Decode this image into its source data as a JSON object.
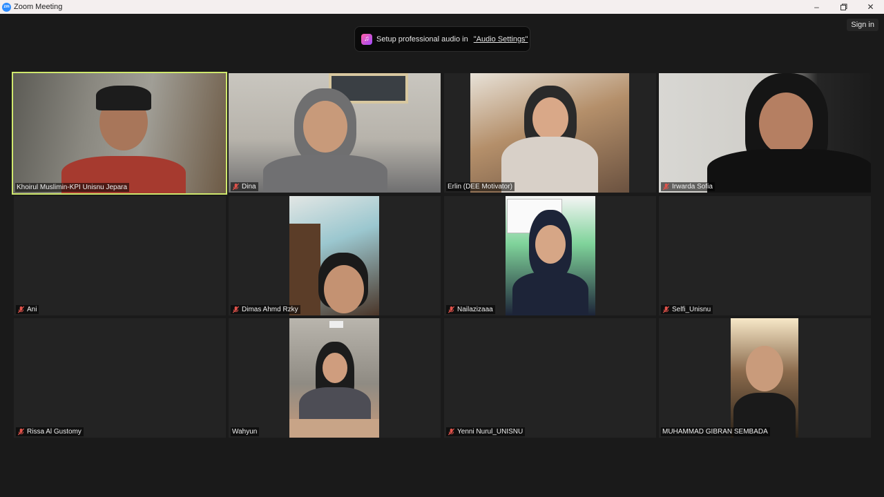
{
  "window": {
    "title": "Zoom Meeting",
    "app_logo": "zm",
    "controls": [
      "minimize-icon",
      "restore-icon",
      "close-icon"
    ]
  },
  "header": {
    "sign_in": "Sign in"
  },
  "notification": {
    "text": "Setup professional audio in",
    "link": "\"Audio Settings\""
  },
  "participants": [
    {
      "name": "Khoirul Muslimin-KPI Unisnu Jepara",
      "muted": false,
      "video": true,
      "active_speaker": true
    },
    {
      "name": "Dina",
      "muted": true,
      "video": true
    },
    {
      "name": "Erlin (DEE Motivator)",
      "muted": false,
      "video": true
    },
    {
      "name": "Irwarda Sofia",
      "muted": true,
      "video": true
    },
    {
      "name": "Ani",
      "muted": true,
      "video": false
    },
    {
      "name": "Dimas Ahmd Rzky",
      "muted": true,
      "video": true
    },
    {
      "name": "Nailazizaaa",
      "muted": true,
      "video": true
    },
    {
      "name": "Selfi_Unisnu",
      "muted": true,
      "video": false
    },
    {
      "name": "Rissa Al Gustomy",
      "muted": true,
      "video": false
    },
    {
      "name": "Wahyun",
      "muted": false,
      "video": true
    },
    {
      "name": "Yenni Nurul_UNISNU",
      "muted": true,
      "video": false
    },
    {
      "name": "MUHAMMAD GIBRAN SEMBADA",
      "muted": false,
      "video": true
    }
  ],
  "colors": {
    "background": "#1a1a1a",
    "tile": "#232323",
    "active_border": "#cfe86d",
    "muted_icon": "#e0524a"
  }
}
